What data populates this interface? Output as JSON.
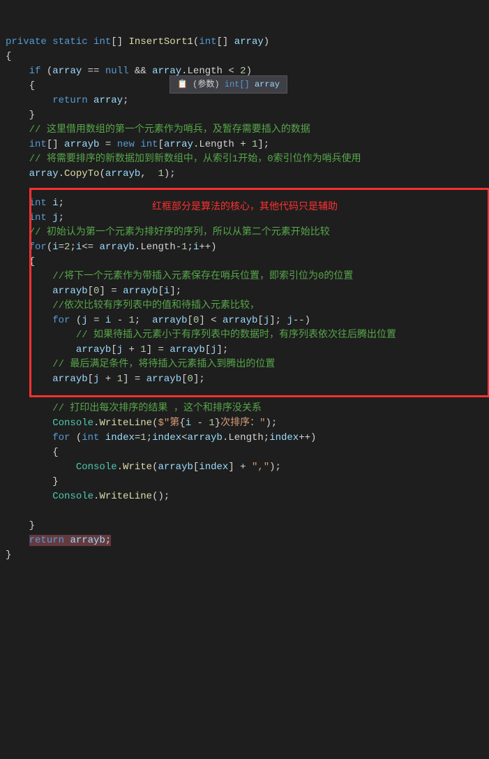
{
  "tooltip": {
    "prefix": "📋 (参数)",
    "type": "int[]",
    "name": "array"
  },
  "annotation": "红框部分是算法的核心，其他代码只是辅助",
  "lines": {
    "0": {
      "t0": "private",
      "t1": "static",
      "t2": "int",
      "t3": "InsertSort1",
      "t4": "int",
      "t5": "array"
    },
    "2": {
      "t0": "if",
      "t1": "array",
      "t2": "null",
      "t3": "array",
      "t4": "Length",
      "t5": "2"
    },
    "4": {
      "t0": "return",
      "t1": "array"
    },
    "6": {
      "t0": "// 这里借用数组的第一个元素作为哨兵，及暂存需要插入的数据"
    },
    "7": {
      "t0": "int",
      "t1": "arrayb",
      "t2": "new",
      "t3": "int",
      "t4": "array",
      "t5": "Length",
      "t6": "1"
    },
    "8": {
      "t0": "// 将需要排序的新数据加到新数组中，从索引1开始，0索引位作为哨兵使用"
    },
    "9": {
      "t0": "array",
      "t1": "CopyTo",
      "t2": "arrayb",
      "t3": "1"
    },
    "11": {
      "t0": "int",
      "t1": "i"
    },
    "12": {
      "t0": "int",
      "t1": "j"
    },
    "13": {
      "t0": "// 初始认为第一个元素为排好序的序列，所以从第二个元素开始比较"
    },
    "14": {
      "t0": "for",
      "t1": "i",
      "t2": "2",
      "t3": "i",
      "t4": "arrayb",
      "t5": "Length",
      "t6": "1",
      "t7": "i"
    },
    "16": {
      "t0": "//将下一个元素作为带插入元素保存在哨兵位置，即索引位为0的位置"
    },
    "17": {
      "t0": "arrayb",
      "t1": "0",
      "t2": "arrayb",
      "t3": "i"
    },
    "18": {
      "t0": "//依次比较有序列表中的值和待插入元素比较，"
    },
    "19": {
      "t0": "for",
      "t1": "j",
      "t2": "i",
      "t3": "1",
      "t4": "arrayb",
      "t5": "0",
      "t6": "arrayb",
      "t7": "j",
      "t8": "j"
    },
    "20": {
      "t0": "// 如果待插入元素小于有序列表中的数据时，有序列表依次往后腾出位置"
    },
    "21": {
      "t0": "arrayb",
      "t1": "j",
      "t2": "1",
      "t3": "arrayb",
      "t4": "j"
    },
    "22": {
      "t0": "// 最后满足条件，将待插入元素插入到腾出的位置"
    },
    "23": {
      "t0": "arrayb",
      "t1": "j",
      "t2": "1",
      "t3": "arrayb",
      "t4": "0"
    },
    "25": {
      "t0": "// 打印出每次排序的结果 ，这个和排序没关系"
    },
    "26": {
      "t0": "Console",
      "t1": "WriteLine",
      "t2": "$\"第",
      "t3": "i",
      "t4": "1",
      "t5": "次排序：\""
    },
    "27": {
      "t0": "for",
      "t1": "int",
      "t2": "index",
      "t3": "1",
      "t4": "index",
      "t5": "arrayb",
      "t6": "Length",
      "t7": "index"
    },
    "29": {
      "t0": "Console",
      "t1": "Write",
      "t2": "arrayb",
      "t3": "index",
      "t4": "\",\""
    },
    "31": {
      "t0": "Console",
      "t1": "WriteLine"
    },
    "34": {
      "t0": "return",
      "t1": "arrayb"
    }
  }
}
